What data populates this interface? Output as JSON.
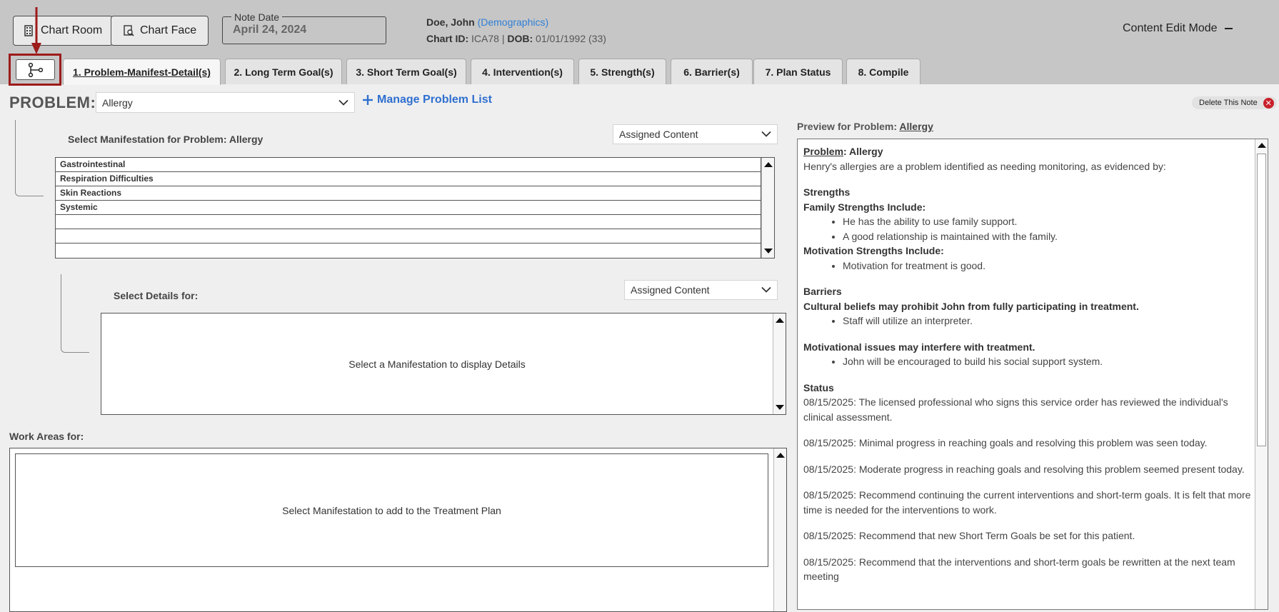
{
  "header": {
    "chart_room_label": "Chart Room",
    "chart_face_label": "Chart Face",
    "note_date_label": "Note Date",
    "note_date_value": "April 24, 2024",
    "patient_name": "Doe, John",
    "demographics_link": "(Demographics)",
    "chart_id_label": "Chart ID:",
    "chart_id_value": "ICA78",
    "separator": "|",
    "dob_label": "DOB:",
    "dob_value": "01/01/1992 (33)",
    "content_edit_mode": "Content Edit Mode"
  },
  "tabs": [
    {
      "label": "1. Problem-Manifest-Detail(s)",
      "active": true
    },
    {
      "label": "2. Long Term Goal(s)"
    },
    {
      "label": "3. Short Term Goal(s)"
    },
    {
      "label": "4. Intervention(s)"
    },
    {
      "label": "5. Strength(s)"
    },
    {
      "label": "6. Barrier(s)"
    },
    {
      "label": "7. Plan Status"
    },
    {
      "label": "8. Compile"
    }
  ],
  "problem": {
    "label": "PROBLEM:",
    "selected": "Allergy",
    "manage_label": "Manage Problem List",
    "delete_note_label": "Delete This Note"
  },
  "manifestation": {
    "title": "Select Manifestation for Problem: Allergy",
    "filter_selected": "Assigned Content",
    "items": [
      "Gastrointestinal",
      "Respiration Difficulties",
      "Skin Reactions",
      "Systemic",
      "",
      "",
      ""
    ]
  },
  "details": {
    "title": "Select Details for:",
    "filter_selected": "Assigned Content",
    "empty_message": "Select a Manifestation to display Details"
  },
  "work_areas": {
    "title": "Work Areas for:",
    "empty_message": "Select Manifestation to add to the Treatment Plan"
  },
  "preview": {
    "title_prefix": "Preview for Problem:",
    "title_problem": "Allergy",
    "problem_label": "Problem",
    "problem_value": ": Allergy",
    "intro": "Henry's allergies are a problem identified as needing monitoring, as evidenced by:",
    "strengths_heading": "Strengths",
    "family_heading": "Family Strengths Include:",
    "family_items": [
      "He has the ability to use family support.",
      "A good relationship is maintained with the family."
    ],
    "motivation_heading": "Motivation Strengths Include:",
    "motivation_items": [
      "Motivation for treatment is good."
    ],
    "barriers_heading": "Barriers",
    "barrier1_heading": "Cultural beliefs may prohibit John from fully participating in treatment.",
    "barrier1_items": [
      "Staff will utilize an interpreter."
    ],
    "barrier2_heading": "Motivational issues may interfere with treatment.",
    "barrier2_items": [
      "John will be encouraged to build his social support system."
    ],
    "status_heading": "Status",
    "status_items": [
      "08/15/2025: The licensed professional who signs this service order has reviewed the individual's clinical assessment.",
      "08/15/2025: Minimal progress in reaching goals and resolving this problem was seen today.",
      "08/15/2025: Moderate progress in reaching goals and resolving this problem seemed present today.",
      "08/15/2025: Recommend continuing the current interventions and short-term goals. It is felt that more time is needed for the interventions to work.",
      "08/15/2025: Recommend that new Short Term Goals be set for this patient.",
      "08/15/2025: Recommend that the interventions and short-term goals be rewritten at the next team meeting"
    ]
  },
  "colors": {
    "header_bg": "#c6c6c6",
    "link": "#2f7fd6",
    "highlight": "#9d1b1b",
    "delete": "#c8202a"
  }
}
